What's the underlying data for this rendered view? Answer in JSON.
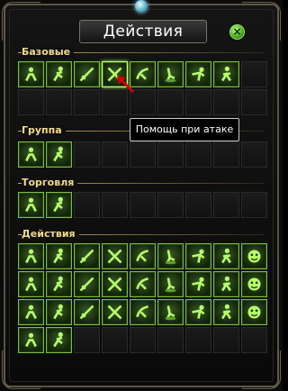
{
  "window": {
    "title": "Действия",
    "close_glyph": "×"
  },
  "sections": {
    "basic": {
      "label": "Базовые"
    },
    "group": {
      "label": "Группа"
    },
    "trade": {
      "label": "Торговля"
    },
    "actions": {
      "label": "Действия"
    }
  },
  "tooltip": {
    "text": "Помощь при атаке"
  },
  "icons": {
    "basic": [
      "sit-icon",
      "run-icon",
      "attack-icon",
      "assist-icon",
      "pickup-icon",
      "push-icon",
      "bow-icon",
      "walk-icon"
    ],
    "group": [
      "party-invite-icon",
      "party-leave-icon"
    ],
    "trade": [
      "trade-icon",
      "private-store-icon"
    ],
    "actions": [
      "greet-icon",
      "victory-icon",
      "advance-icon",
      "no-icon",
      "yes-icon",
      "bow-social-icon",
      "unaware-icon",
      "social-wait-icon",
      "laugh-icon",
      "applause-icon",
      "dance-icon",
      "sorrow-icon",
      "charm-icon",
      "shyness-icon",
      "exchange-bow-icon",
      "high-five-icon",
      "couple-dance-icon",
      "pose-icon",
      "jump-icon",
      "fist-icon",
      "look-icon",
      "kick-icon",
      "rest-icon",
      "stretch-icon",
      "taunt-icon",
      "shield-guard-icon",
      "point-icon",
      "lie-down-icon",
      "push-up-icon"
    ]
  },
  "colors": {
    "accent": "#7cbf3c",
    "section_label": "#f2d98b",
    "tooltip_border": "#c8c8c8"
  }
}
